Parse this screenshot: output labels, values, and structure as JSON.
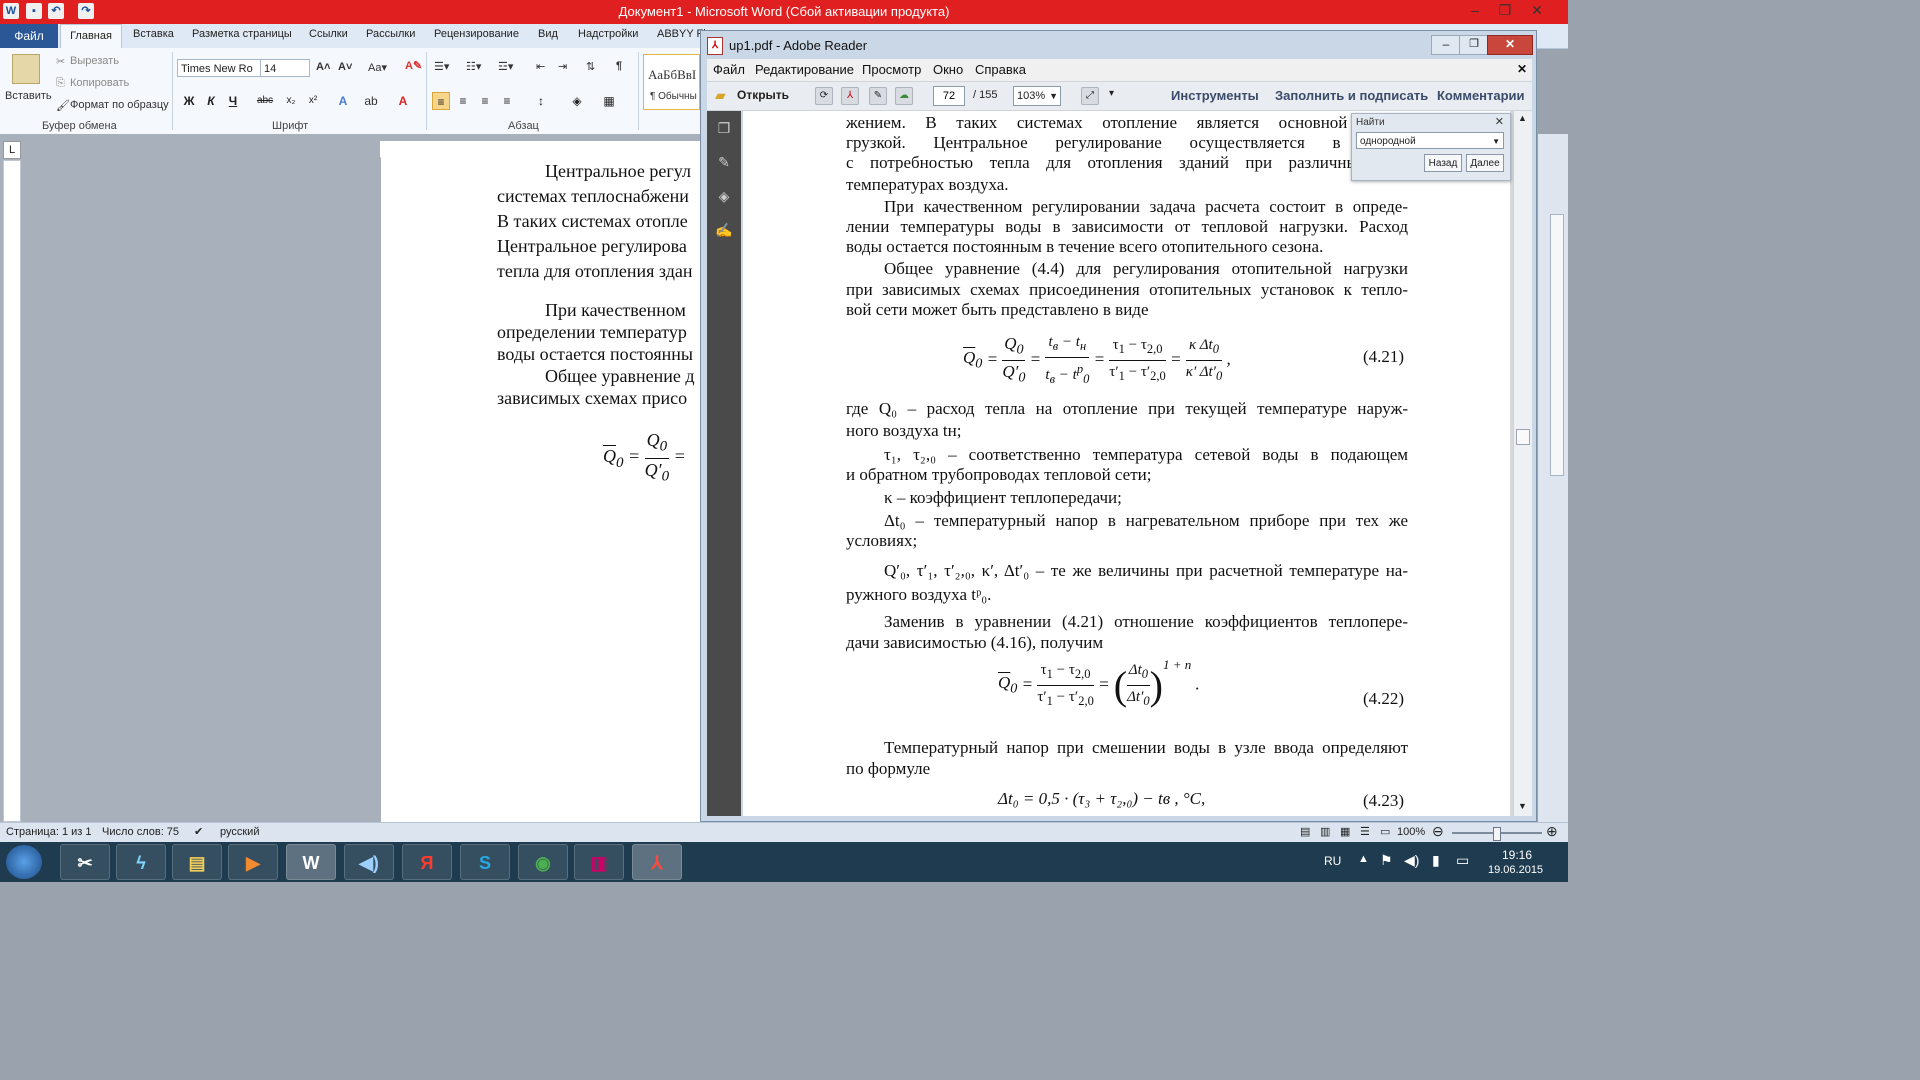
{
  "word": {
    "title": "Документ1 - Microsoft Word (Сбой активации продукта)",
    "tabs": [
      "Файл",
      "Главная",
      "Вставка",
      "Разметка страницы",
      "Ссылки",
      "Рассылки",
      "Рецензирование",
      "Вид",
      "Надстройки",
      "ABBYY Fi"
    ],
    "clipboard": {
      "paste": "Вставить",
      "cut": "Вырезать",
      "copy": "Копировать",
      "format_painter": "Формат по образцу",
      "group": "Буфер обмена"
    },
    "font": {
      "name": "Times New Ro",
      "size": "14",
      "group": "Шрифт"
    },
    "paragraph_group": "Абзац",
    "style_preview": "АаБбВвІ",
    "style_name": "¶ Обычны",
    "doc_lines": [
      "Центральное регул",
      "системах теплоснабжени",
      "В таких системах отопле",
      "Центральное регулирова",
      "тепла для отопления здан",
      "При качественном",
      "определении температур",
      "воды остается постоянны",
      "Общее уравнение д",
      "зависимых схемах присо"
    ],
    "status": {
      "page": "Страница: 1 из 1",
      "words": "Число слов: 75",
      "lang": "русский",
      "zoom": "100%"
    }
  },
  "reader": {
    "title": "up1.pdf - Adobe Reader",
    "menu": [
      "Файл",
      "Редактирование",
      "Просмотр",
      "Окно",
      "Справка"
    ],
    "open_label": "Открыть",
    "page_current": "72",
    "page_total": "/ 155",
    "zoom": "103%",
    "panes": [
      "Инструменты",
      "Заполнить и подписать",
      "Комментарии"
    ],
    "find": {
      "label": "Найти",
      "value": "однородной",
      "back": "Назад",
      "next": "Далее"
    },
    "text": {
      "l1": "жением. В таких системах отопление является основной тепло",
      "l2": "грузкой. Центральное регулирование осуществляется в соотв",
      "l3": "с потребностью тепла для отопления зданий при различных нар",
      "l4": "температурах воздуха.",
      "l5": "При качественном регулировании задача расчета состоит в опреде-",
      "l6": "лении температуры воды в зависимости от тепловой нагрузки. Расход",
      "l7": "воды остается постоянным в течение всего отопительного сезона.",
      "l8": "Общее уравнение (4.4) для регулирования отопительной нагрузки",
      "l9": "при зависимых схемах присоединения отопительных установок к тепло-",
      "l10": "вой сети может быть представлено в виде",
      "eq421_num": "(4.21)",
      "l11": "где    Q₀ – расход тепла на отопление при текущей температуре наруж-",
      "l12": "ного воздуха tн;",
      "l13": "τ₁, τ₂,₀ – соответственно температура сетевой воды в подающем",
      "l14": "и обратном трубопроводах тепловой сети;",
      "l15": "κ – коэффициент теплопередачи;",
      "l16": "Δt₀ – температурный напор в нагревательном приборе при тех же",
      "l17": "условиях;",
      "l18": "Q′₀, τ′₁, τ′₂,₀, κ′, Δt′₀ – те же величины при расчетной температуре на-",
      "l19": "ружного воздуха tᵖ₀.",
      "l20": "Заменив в уравнении (4.21) отношение коэффициентов теплопере-",
      "l21": "дачи зависимостью (4.16), получим",
      "eq422_num": "(4.22)",
      "l22": "Температурный напор при смешении воды в узле ввода определяют",
      "l23": "по формуле",
      "eq423": "Δt₀ = 0,5 · (τ₃ + τ₂,₀) − tв , °С,",
      "eq423_num": "(4.23)"
    }
  },
  "taskbar": {
    "lang": "RU",
    "time": "19:16",
    "date": "19.06.2015"
  }
}
